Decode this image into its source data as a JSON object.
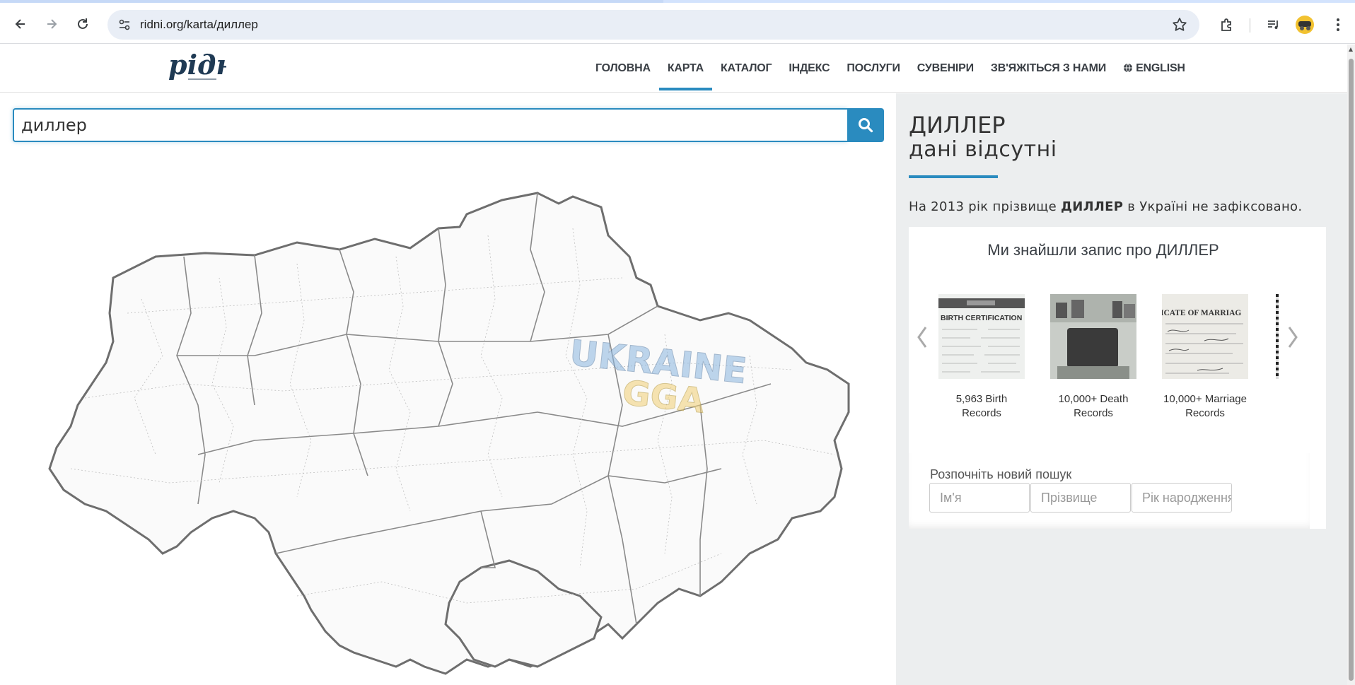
{
  "browser": {
    "url": "ridni.org/karta/диллер"
  },
  "header": {
    "logo_text": "рідні",
    "menu": [
      {
        "label": "ГОЛОВНА",
        "active": false
      },
      {
        "label": "КАРТА",
        "active": true
      },
      {
        "label": "КАТАЛОГ",
        "active": false
      },
      {
        "label": "ІНДЕКС",
        "active": false
      },
      {
        "label": "ПОСЛУГИ",
        "active": false
      },
      {
        "label": "СУВЕНІРИ",
        "active": false
      },
      {
        "label": "ЗВ'ЯЖІТЬСЯ З НАМИ",
        "active": false
      }
    ],
    "language_label": "ENGLISH"
  },
  "search": {
    "value": "диллер"
  },
  "result": {
    "surname": "ДИЛЛЕР",
    "status": "дані відсутні",
    "text_before": "На 2013 рік прізвище ",
    "text_name": "ДИЛЛЕР",
    "text_after": " в Україні не зафіксовано."
  },
  "records_card": {
    "title": "Ми знайшли запис про ДИЛЛЕР",
    "items": [
      {
        "label": "5,963 Birth Records",
        "thumb_text": "BIRTH CERTIFICATION",
        "icon": "birth-certificate-thumbnail"
      },
      {
        "label": "10,000+ Death Records",
        "icon": "gravestone-thumbnail"
      },
      {
        "label": "10,000+ Marriage Records",
        "thumb_text": "ICATE OF MARRIAG",
        "icon": "marriage-certificate-thumbnail"
      }
    ]
  },
  "new_search": {
    "label": "Розпочніть новий пошук",
    "first_name_placeholder": "Ім'я",
    "last_name_placeholder": "Прізвище",
    "birth_year_placeholder": "Рік народження"
  },
  "colors": {
    "accent": "#2a8bbf",
    "panel_bg": "#eceeef",
    "map_stroke": "#6e6e6e"
  }
}
